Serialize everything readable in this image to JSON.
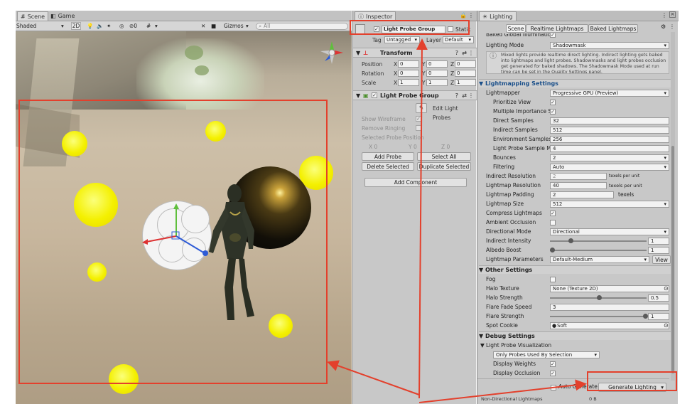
{
  "scene_panel": {
    "tabs": [
      {
        "label": "Scene"
      },
      {
        "label": "Game"
      }
    ],
    "toolbar": {
      "shading": "Shaded",
      "mode_2d": "2D",
      "gizmos": "Gizmos",
      "search_placeholder": "All"
    }
  },
  "inspector": {
    "tab_title": "Inspector",
    "object_name": "Light Probe Group",
    "static_label": "Static",
    "tag_label": "Tag",
    "tag_value": "Untagged",
    "layer_label": "Layer",
    "layer_value": "Default",
    "transform": {
      "title": "Transform",
      "rows": [
        {
          "label": "Position",
          "x": "0",
          "y": "0",
          "z": "0"
        },
        {
          "label": "Rotation",
          "x": "0",
          "y": "0",
          "z": "0"
        },
        {
          "label": "Scale",
          "x": "1",
          "y": "1",
          "z": "1"
        }
      ],
      "x_axis": "X",
      "y_axis": "Y",
      "z_axis": "Z"
    },
    "component": {
      "title": "Light Probe Group",
      "edit_button": "Edit Light Probes",
      "show_wireframe": "Show Wireframe",
      "remove_ringing": "Remove Ringing",
      "selected_position": "Selected Probe Position",
      "sel_x": "X 0",
      "sel_y": "Y 0",
      "sel_z": "Z 0",
      "add_probe": "Add Probe",
      "select_all": "Select All",
      "delete_selected": "Delete Selected",
      "duplicate_selected": "Duplicate Selected"
    },
    "add_component": "Add Component"
  },
  "lighting": {
    "tab_title": "Lighting",
    "tabs": [
      "Scene",
      "Realtime Lightmaps",
      "Baked Lightmaps"
    ],
    "baked_gi_label": "Baked Global Illumination",
    "lighting_mode_label": "Lighting Mode",
    "lighting_mode_value": "Shadowmask",
    "info_text": "Mixed lights provide realtime direct lighting. Indirect lighting gets baked into lightmaps and light probes. Shadowmasks and light probes occlusion get generated for baked shadows. The Shadowmask Mode used at run time can be set in the Quality Settings panel.",
    "lightmapping_settings": "Lightmapping Settings",
    "rows": [
      {
        "label": "Lightmapper",
        "value": "Progressive GPU (Preview)",
        "kind": "select"
      },
      {
        "label": "Prioritize View",
        "value": "✓",
        "kind": "check"
      },
      {
        "label": "Multiple Importance S",
        "value": "✓",
        "kind": "check"
      },
      {
        "label": "Direct Samples",
        "value": "32",
        "kind": "field"
      },
      {
        "label": "Indirect Samples",
        "value": "512",
        "kind": "field"
      },
      {
        "label": "Environment Samples",
        "value": "256",
        "kind": "field"
      },
      {
        "label": "Light Probe Sample M",
        "value": "4",
        "kind": "field"
      },
      {
        "label": "Bounces",
        "value": "2",
        "kind": "select"
      },
      {
        "label": "Filtering",
        "value": "Auto",
        "kind": "select"
      }
    ],
    "indirect_resolution_label": "Indirect Resolution",
    "indirect_resolution_value": "2",
    "indirect_resolution_unit": "texels per unit",
    "lightmap_resolution_label": "Lightmap Resolution",
    "lightmap_resolution_value": "40",
    "lightmap_resolution_unit": "texels per unit",
    "lightmap_padding_label": "Lightmap Padding",
    "lightmap_padding_value": "2",
    "lightmap_padding_unit": "texels",
    "lightmap_size_label": "Lightmap Size",
    "lightmap_size_value": "512",
    "compress_label": "Compress Lightmaps",
    "ao_label": "Ambient Occlusion",
    "directional_label": "Directional Mode",
    "directional_value": "Directional",
    "indirect_intensity_label": "Indirect Intensity",
    "indirect_intensity_value": "1",
    "albedo_boost_label": "Albedo Boost",
    "albedo_boost_value": "1",
    "lightmap_params_label": "Lightmap Parameters",
    "lightmap_params_value": "Default-Medium",
    "view_button": "View",
    "other_settings": "Other Settings",
    "fog_label": "Fog",
    "halo_texture_label": "Halo Texture",
    "halo_texture_value": "None (Texture 2D)",
    "halo_strength_label": "Halo Strength",
    "halo_strength_value": "0.5",
    "flare_fade_label": "Flare Fade Speed",
    "flare_fade_value": "3",
    "flare_strength_label": "Flare Strength",
    "flare_strength_value": "1",
    "spot_cookie_label": "Spot Cookie",
    "spot_cookie_value": "Soft",
    "debug_settings": "Debug Settings",
    "probe_vis_label": "Light Probe Visualization",
    "probe_vis_value": "Only Probes Used By Selection",
    "display_weights_label": "Display Weights",
    "display_occlusion_label": "Display Occlusion",
    "auto_generate_label": "Auto Generate",
    "generate_button": "Generate Lighting",
    "footer": "Non-Directional Lightmaps",
    "footer_size": "0 B"
  }
}
